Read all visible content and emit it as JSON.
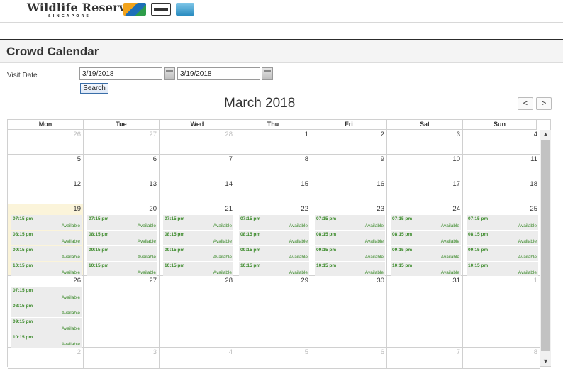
{
  "brand": {
    "name": "Wildlife Reserves",
    "sub": "SINGAPORE"
  },
  "panel": {
    "title": "Crowd Calendar"
  },
  "form": {
    "visit_label": "Visit Date",
    "date_from": "3/19/2018",
    "date_to": "3/19/2018",
    "search_label": "Search"
  },
  "calendar": {
    "month_title": "March 2018",
    "prev_label": "<",
    "next_label": ">",
    "days_of_week": [
      "Mon",
      "Tue",
      "Wed",
      "Thu",
      "Fri",
      "Sat",
      "Sun"
    ],
    "weeks": [
      {
        "days": [
          {
            "n": "26",
            "other": true
          },
          {
            "n": "27",
            "other": true
          },
          {
            "n": "28",
            "other": true
          },
          {
            "n": "1"
          },
          {
            "n": "2"
          },
          {
            "n": "3"
          },
          {
            "n": "4"
          }
        ]
      },
      {
        "days": [
          {
            "n": "5"
          },
          {
            "n": "6"
          },
          {
            "n": "7"
          },
          {
            "n": "8"
          },
          {
            "n": "9"
          },
          {
            "n": "10"
          },
          {
            "n": "11"
          }
        ]
      },
      {
        "days": [
          {
            "n": "12"
          },
          {
            "n": "13"
          },
          {
            "n": "14"
          },
          {
            "n": "15"
          },
          {
            "n": "16"
          },
          {
            "n": "17"
          },
          {
            "n": "18"
          }
        ]
      },
      {
        "days": [
          {
            "n": "19",
            "today": true,
            "slots": true
          },
          {
            "n": "20",
            "slots": true
          },
          {
            "n": "21",
            "slots": true
          },
          {
            "n": "22",
            "slots": true
          },
          {
            "n": "23",
            "slots": true
          },
          {
            "n": "24",
            "slots": true
          },
          {
            "n": "25",
            "slots": true
          }
        ]
      },
      {
        "days": [
          {
            "n": "26",
            "slots": true
          },
          {
            "n": "27"
          },
          {
            "n": "28"
          },
          {
            "n": "29"
          },
          {
            "n": "30"
          },
          {
            "n": "31"
          },
          {
            "n": "1",
            "other": true
          }
        ]
      },
      {
        "days": [
          {
            "n": "2",
            "other": true
          },
          {
            "n": "3",
            "other": true
          },
          {
            "n": "4",
            "other": true
          },
          {
            "n": "5",
            "other": true
          },
          {
            "n": "6",
            "other": true
          },
          {
            "n": "7",
            "other": true
          },
          {
            "n": "8",
            "other": true
          }
        ]
      }
    ],
    "slot_times": [
      "07:15 pm",
      "08:15 pm",
      "09:15 pm",
      "10:15 pm"
    ],
    "slot_status": "Available"
  },
  "colors": {
    "available": "#3b8a2a",
    "today": "#fbf4da"
  }
}
